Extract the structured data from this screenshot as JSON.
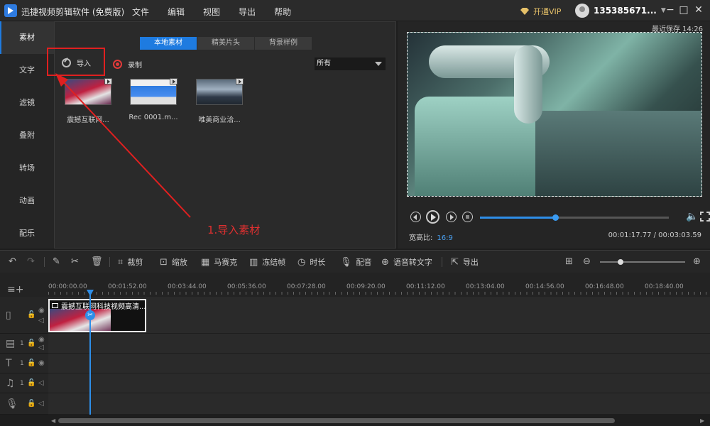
{
  "app": {
    "title": "迅捷视频剪辑软件 (免费版)",
    "menu": [
      "文件",
      "编辑",
      "视图",
      "导出",
      "帮助"
    ],
    "vip_label": "开通VIP",
    "username": "135385671...",
    "window_controls": [
      "−",
      "□",
      "✕"
    ]
  },
  "sidebar": {
    "items": [
      {
        "label": "素材",
        "active": true
      },
      {
        "label": "文字"
      },
      {
        "label": "滤镜"
      },
      {
        "label": "叠附"
      },
      {
        "label": "转场"
      },
      {
        "label": "动画"
      },
      {
        "label": "配乐"
      }
    ]
  },
  "media": {
    "tabs": [
      "本地素材",
      "精美片头",
      "背景样例"
    ],
    "import_label": "导入",
    "record_label": "录制",
    "filter_value": "所有",
    "items": [
      {
        "name": "震撼互联网..."
      },
      {
        "name": "Rec 0001.m..."
      },
      {
        "name": "唯美商业洽..."
      }
    ],
    "annotation": "1.导入素材"
  },
  "preview": {
    "autosave": "最近保存 14:26",
    "progress": 0.4,
    "aspect_label": "宽高比:",
    "aspect_value": "16:9",
    "timecode": "00:01:17.77 / 00:03:03.59"
  },
  "toolbar": {
    "crop": "裁剪",
    "zoom": "缩放",
    "mosaic": "马赛克",
    "freeze": "冻结帧",
    "duration": "时长",
    "voiceover": "配音",
    "speech_to_text": "语音转文字",
    "export": "导出",
    "zoom_level": 0.24
  },
  "timeline": {
    "ticks": [
      "00:00:00.00",
      "00:01:52.00",
      "00:03:44.00",
      "00:05:36.00",
      "00:07:28.00",
      "00:09:20.00",
      "00:11:12.00",
      "00:13:04.00",
      "00:14:56.00",
      "00:16:48.00",
      "00:18:40.00"
    ],
    "clip_name": "震撼互联网科技视频高清...",
    "track_numbers": [
      "1",
      "1",
      "1"
    ]
  },
  "colors": {
    "accent": "#1e7be0",
    "annotation": "#e02020",
    "vip": "#e6c169"
  }
}
